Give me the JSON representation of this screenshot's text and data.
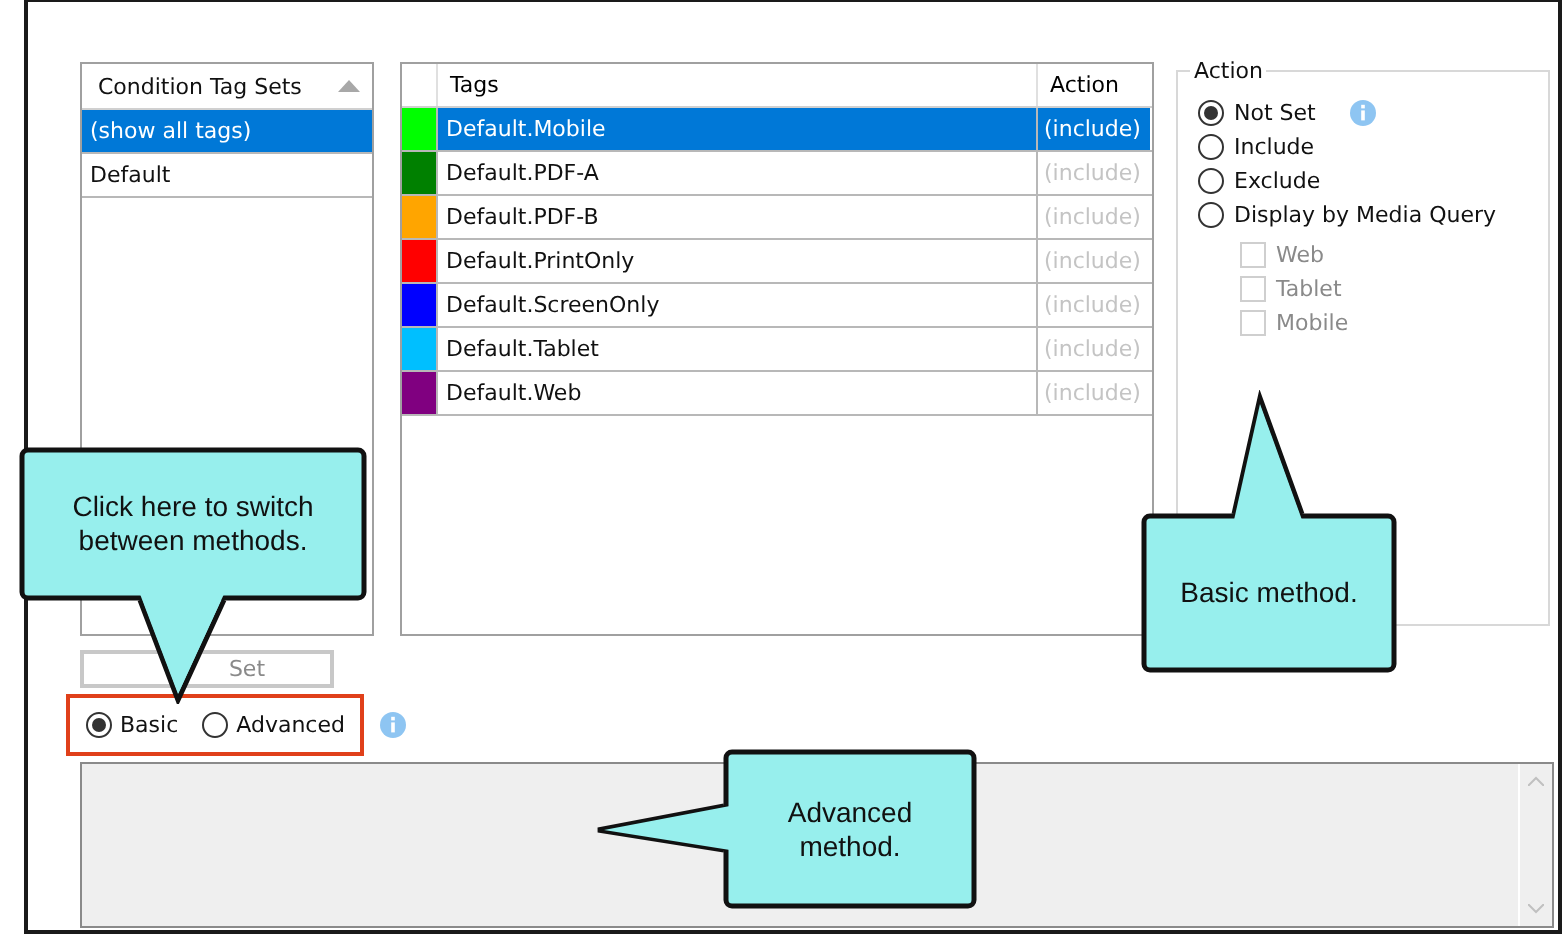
{
  "condition_tag_sets": {
    "header": "Condition Tag Sets",
    "items": [
      {
        "label": "(show all tags)",
        "selected": true
      },
      {
        "label": "Default",
        "selected": false
      }
    ]
  },
  "tags_table": {
    "columns": [
      "Tags",
      "Action"
    ],
    "rows": [
      {
        "name": "Default.Mobile",
        "action": "(include)",
        "color": "#00ff00",
        "selected": true
      },
      {
        "name": "Default.PDF-A",
        "action": "(include)",
        "color": "#008000",
        "selected": false
      },
      {
        "name": "Default.PDF-B",
        "action": "(include)",
        "color": "#ffa500",
        "selected": false
      },
      {
        "name": "Default.PrintOnly",
        "action": "(include)",
        "color": "#ff0000",
        "selected": false
      },
      {
        "name": "Default.ScreenOnly",
        "action": "(include)",
        "color": "#0000ff",
        "selected": false
      },
      {
        "name": "Default.Tablet",
        "action": "(include)",
        "color": "#00bfff",
        "selected": false
      },
      {
        "name": "Default.Web",
        "action": "(include)",
        "color": "#800080",
        "selected": false
      }
    ]
  },
  "action_group": {
    "title": "Action",
    "options": [
      {
        "label": "Not Set",
        "selected": true
      },
      {
        "label": "Include",
        "selected": false
      },
      {
        "label": "Exclude",
        "selected": false
      },
      {
        "label": "Display by Media Query",
        "selected": false
      }
    ],
    "media_queries": [
      {
        "label": "Web",
        "checked": false,
        "disabled": true
      },
      {
        "label": "Tablet",
        "checked": false,
        "disabled": true
      },
      {
        "label": "Mobile",
        "checked": false,
        "disabled": true
      }
    ]
  },
  "edit_set_button": {
    "label": "Set"
  },
  "method": {
    "options": [
      {
        "label": "Basic",
        "selected": true
      },
      {
        "label": "Advanced",
        "selected": false
      }
    ]
  },
  "callouts": [
    {
      "text": "Click here to switch between methods.",
      "kind": "down"
    },
    {
      "text": "Basic method.",
      "kind": "up"
    },
    {
      "text": "Advanced method.",
      "kind": "left"
    }
  ]
}
